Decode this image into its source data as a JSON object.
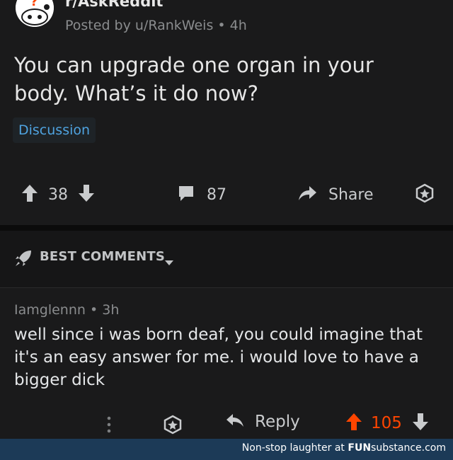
{
  "post": {
    "subreddit": "r/AskReddit",
    "posted_by": "Posted by u/RankWeis",
    "separator": "•",
    "age": "4h",
    "title": "You can upgrade one organ in your body. What’s it do now?",
    "flair": "Discussion",
    "vote_count": "38",
    "comment_count": "87",
    "share_label": "Share"
  },
  "comments_sort": {
    "label": "BEST COMMENTS"
  },
  "comment": {
    "author": "Iamglennn",
    "separator": "•",
    "age": "3h",
    "body": "well since i was born deaf, you could imagine that it's an easy answer for me. i would love to have a bigger dick",
    "reply_label": "Reply",
    "vote_count": "105"
  },
  "footer": {
    "tagline": "Non-stop laughter at",
    "brand_bold": "FUN",
    "brand_rest": "substance.com"
  },
  "colors": {
    "upvote_active": "#ff4500",
    "link_blue": "#4fa3e0",
    "footer_bg": "#1c3a57"
  },
  "icons": [
    "snoo-avatar-icon",
    "upvote-arrow-icon",
    "downvote-arrow-icon",
    "comment-bubble-icon",
    "share-arrow-icon",
    "award-icon",
    "rocket-icon",
    "chevron-down-icon",
    "more-vertical-icon",
    "reply-arrow-icon"
  ]
}
